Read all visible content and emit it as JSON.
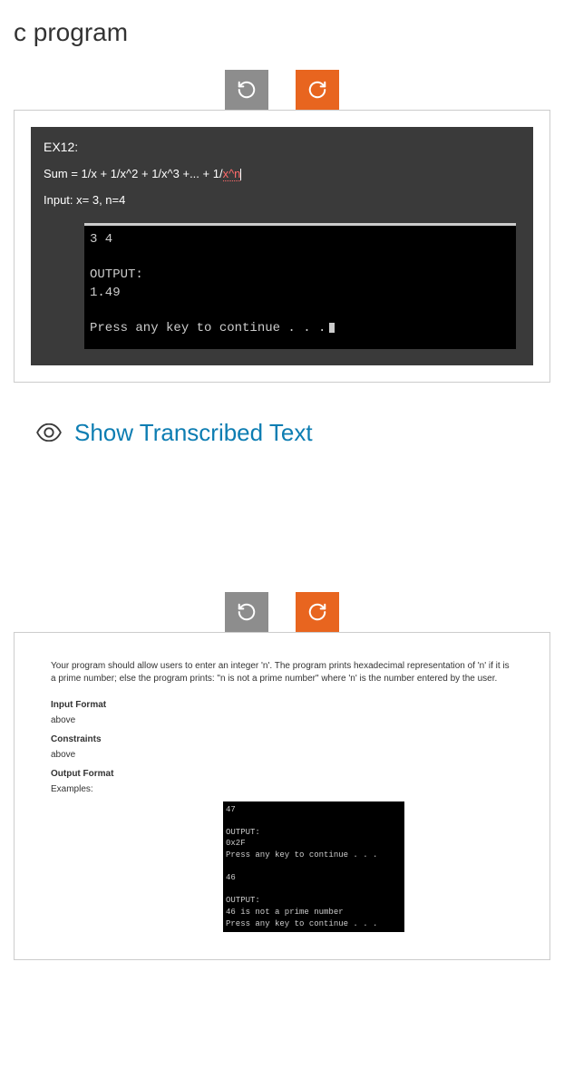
{
  "title": "c program",
  "section1": {
    "ex_title": "EX12:",
    "formula_pre": "Sum = 1/x + 1/x^2 + 1/x^3 +... + 1/",
    "formula_underlined": "x^n",
    "input_label": "Input: x= 3, n=4",
    "console": "3 4\n\nOUTPUT:\n1.49\n\nPress any key to continue . . ."
  },
  "show_transcribed": "Show Transcribed Text",
  "section2": {
    "description": "Your program should allow users to enter an integer 'n'. The program prints hexadecimal representation of 'n' if it is a prime number; else the program prints: \"n is not a prime number\" where 'n' is the number entered by the user.",
    "input_format_label": "Input Format",
    "input_format_text": "above",
    "constraints_label": "Constraints",
    "constraints_text": "above",
    "output_format_label": "Output Format",
    "examples_label": "Examples:",
    "console": "47\n\nOUTPUT:\n0x2F\nPress any key to continue . . .\n\n46\n\nOUTPUT:\n46 is not a prime number\nPress any key to continue . . ."
  }
}
